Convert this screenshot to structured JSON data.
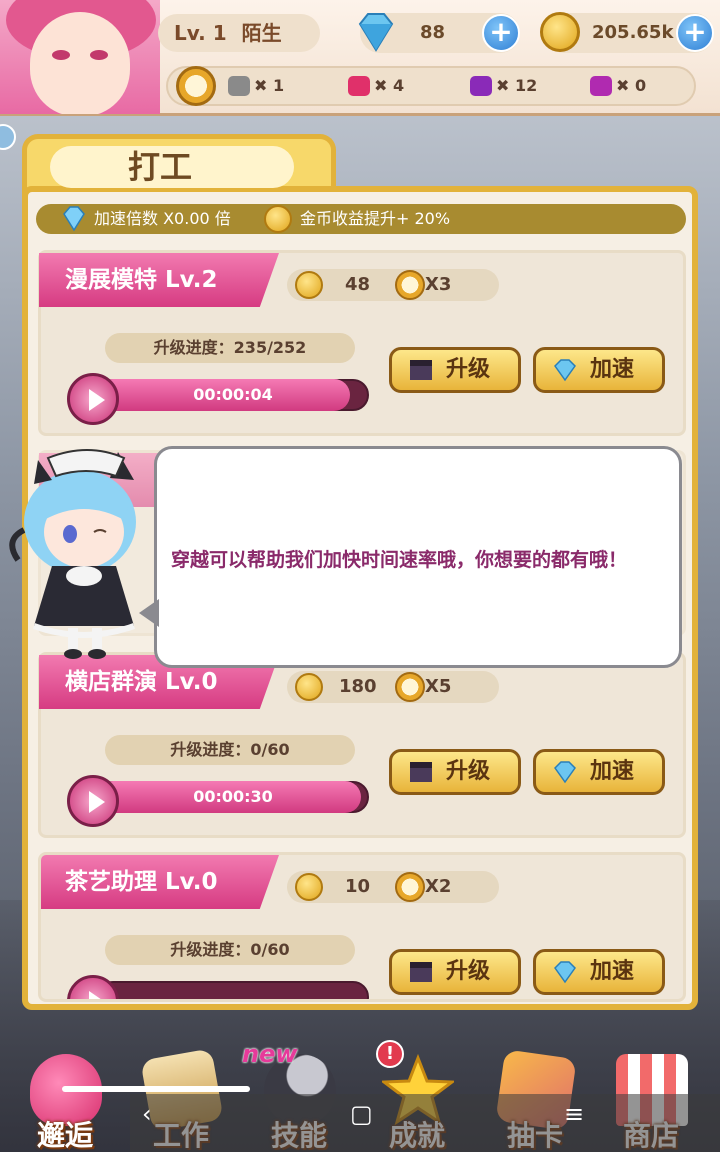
{
  "header": {
    "level": "Lv. 1",
    "player_name": "陌生",
    "diamonds": "88",
    "gold": "205.65k"
  },
  "items": {
    "grey": "1",
    "pink": "4",
    "purple": "12",
    "magenta": "0"
  },
  "panel": {
    "title": "打工",
    "speed_label": "加速倍数 X0.00 倍",
    "bonus_label": "金币收益提升+ 20%"
  },
  "jobs": [
    {
      "title": "漫展模特 Lv.2",
      "coins": "48",
      "multiplier": "X3",
      "progress_text": "升级进度：235/252",
      "progress_fraction": 0.93,
      "time": "00:00:04",
      "upgrade_label": "升级",
      "speed_label": "加速"
    },
    {
      "title": "横店群演 Lv.0",
      "coins": "180",
      "multiplier": "X5",
      "progress_text": "升级进度：0/60",
      "progress_fraction": 0.97,
      "time": "00:00:30",
      "upgrade_label": "升级",
      "speed_label": "加速"
    },
    {
      "title": "茶艺助理 Lv.0",
      "coins": "10",
      "multiplier": "X2",
      "progress_text": "升级进度：0/60",
      "progress_fraction": 0.0,
      "time": "",
      "upgrade_label": "升级",
      "speed_label": "加速"
    }
  ],
  "dialog": {
    "text": "穿越可以帮助我们加快时间速率哦，你想要的都有哦！"
  },
  "nav": [
    {
      "label": "邂逅",
      "icon": "hearts-icon"
    },
    {
      "label": "工作",
      "icon": "briefcase-icon"
    },
    {
      "label": "技能",
      "icon": "microphone-icon"
    },
    {
      "label": "成就",
      "icon": "star-icon"
    },
    {
      "label": "抽卡",
      "icon": "cards-icon"
    },
    {
      "label": "商店",
      "icon": "shop-icon"
    }
  ],
  "badges": {
    "new": "new",
    "alert": "!"
  },
  "system_nav": {
    "back": "‹",
    "home": "▢",
    "menu": "≡"
  },
  "colors": {
    "accent_pink": "#d63b82",
    "gold": "#e2b23a",
    "diamond_blue": "#5fb4e8"
  }
}
